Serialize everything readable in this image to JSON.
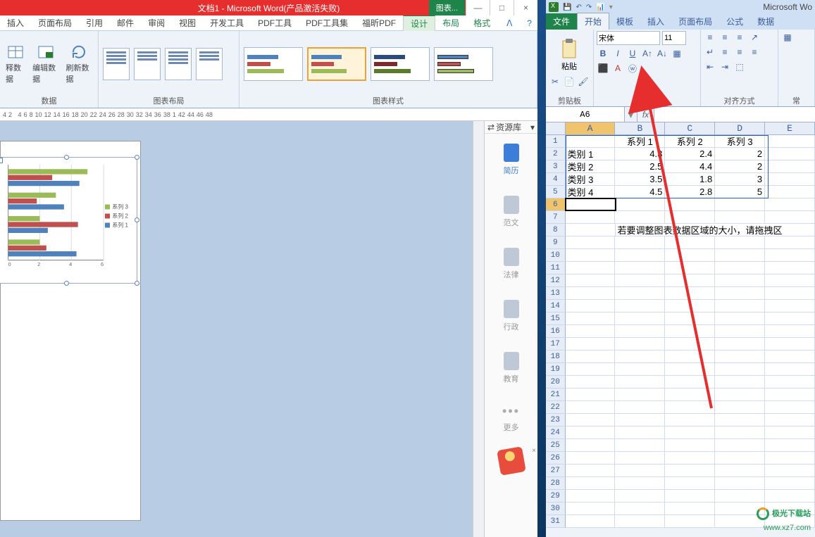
{
  "word": {
    "title": "文档1 - Microsoft Word(产品激活失败)",
    "tool_context": "图表...",
    "win": {
      "min": "—",
      "max": "□",
      "close": "×"
    },
    "tabs": [
      "插入",
      "页面布局",
      "引用",
      "邮件",
      "审阅",
      "视图",
      "开发工具",
      "PDF工具",
      "PDF工具集",
      "福昕PDF",
      "设计",
      "布局",
      "格式"
    ],
    "help_expand": "ᐱ",
    "help_q": "?",
    "ribbon": {
      "data_group": "数据",
      "data_btns": [
        "释数据",
        "编辑数据",
        "刷新数据"
      ],
      "layout_group": "图表布局",
      "styles_group": "图表样式"
    },
    "ruler_marks": [
      "4",
      "2",
      "4",
      "6",
      "8",
      "10",
      "12",
      "14",
      "16",
      "18",
      "20",
      "22",
      "24",
      "26",
      "28",
      "30",
      "32",
      "34",
      "36",
      "38",
      "1",
      "42",
      "44",
      "46",
      "48"
    ]
  },
  "sidepanel": {
    "title": "资源库",
    "items": [
      "简历",
      "范文",
      "法律",
      "行政",
      "教育",
      "更多"
    ]
  },
  "excel": {
    "app_title": "Microsoft Wo",
    "tabs": {
      "file": "文件",
      "start": "开始",
      "template": "模板",
      "insert": "插入",
      "layout": "页面布局",
      "formula": "公式",
      "data": "数据"
    },
    "ribbon": {
      "clipboard": "剪贴板",
      "paste": "粘贴",
      "font_group": "字体",
      "font_name": "宋体",
      "font_size": "11",
      "align_group": "对齐方式",
      "style_group": "常"
    },
    "namebox": "A6",
    "fx": "fx",
    "columns": [
      "",
      "A",
      "B",
      "C",
      "D",
      "E"
    ],
    "headers": {
      "s1": "系列 1",
      "s2": "系列 2",
      "s3": "系列 3"
    },
    "rows": {
      "r2": {
        "cat": "类别 1",
        "v1": "4.3",
        "v2": "2.4",
        "v3": "2"
      },
      "r3": {
        "cat": "类别 2",
        "v1": "2.5",
        "v2": "4.4",
        "v3": "2"
      },
      "r4": {
        "cat": "类别 3",
        "v1": "3.5",
        "v2": "1.8",
        "v3": "3"
      },
      "r5": {
        "cat": "类别 4",
        "v1": "4.5",
        "v2": "2.8",
        "v3": "5"
      }
    },
    "hint": "若要调整图表数据区域的大小，请拖拽区"
  },
  "chart_data": {
    "type": "bar",
    "orientation": "horizontal",
    "categories": [
      "类别 1",
      "类别 2",
      "类别 3",
      "类别 4"
    ],
    "series": [
      {
        "name": "系列 1",
        "values": [
          4.3,
          2.5,
          3.5,
          4.5
        ],
        "color": "#4f81bd"
      },
      {
        "name": "系列 2",
        "values": [
          2.4,
          4.4,
          1.8,
          2.8
        ],
        "color": "#c0504d"
      },
      {
        "name": "系列 3",
        "values": [
          2,
          2,
          3,
          5
        ],
        "color": "#9bbb59"
      }
    ],
    "xlim": [
      0,
      6
    ],
    "xticks": [
      0,
      2,
      4,
      6
    ],
    "legend": [
      "系列 3",
      "系列 2",
      "系列 1"
    ]
  },
  "watermark": {
    "brand": "极光下载站",
    "url": "www.xz7.com"
  }
}
